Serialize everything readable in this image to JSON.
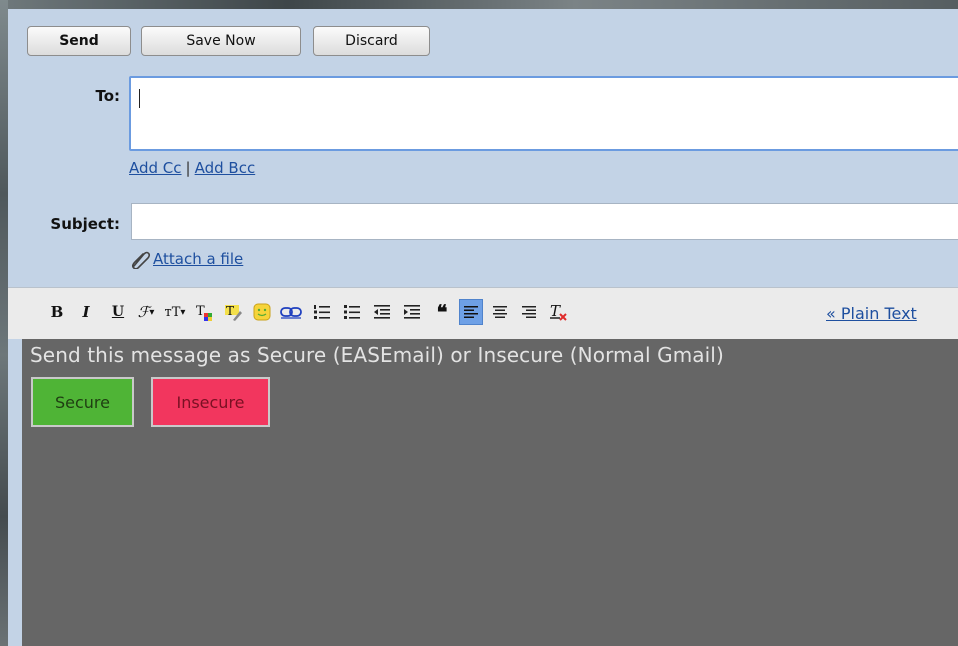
{
  "toolbar": {
    "send_label": "Send",
    "save_label": "Save Now",
    "discard_label": "Discard"
  },
  "compose": {
    "to_label": "To:",
    "to_value": "",
    "add_cc": "Add Cc",
    "link_separator": "|",
    "add_bcc": "Add Bcc",
    "subject_label": "Subject:",
    "subject_value": "",
    "attach_label": "Attach a file"
  },
  "format_toolbar": {
    "icons": [
      "bold-icon",
      "italic-icon",
      "underline-icon",
      "font-icon",
      "font-size-icon",
      "text-color-icon",
      "highlight-icon",
      "emoji-icon",
      "link-icon",
      "numbered-list-icon",
      "bulleted-list-icon",
      "indent-less-icon",
      "indent-more-icon",
      "quote-icon",
      "align-left-icon",
      "align-center-icon",
      "align-right-icon",
      "remove-formatting-icon"
    ],
    "active": "align-left-icon",
    "plain_text_label": "« Plain Text"
  },
  "editor": {
    "message": "Send this message as Secure (EASEmail) or Insecure (Normal Gmail)",
    "secure_label": "Secure",
    "insecure_label": "Insecure"
  },
  "colors": {
    "compose_bg": "#c3d3e6",
    "editor_bg": "#666666",
    "secure": "#4fb436",
    "insecure": "#f2365e",
    "link": "#1e4f9f"
  }
}
